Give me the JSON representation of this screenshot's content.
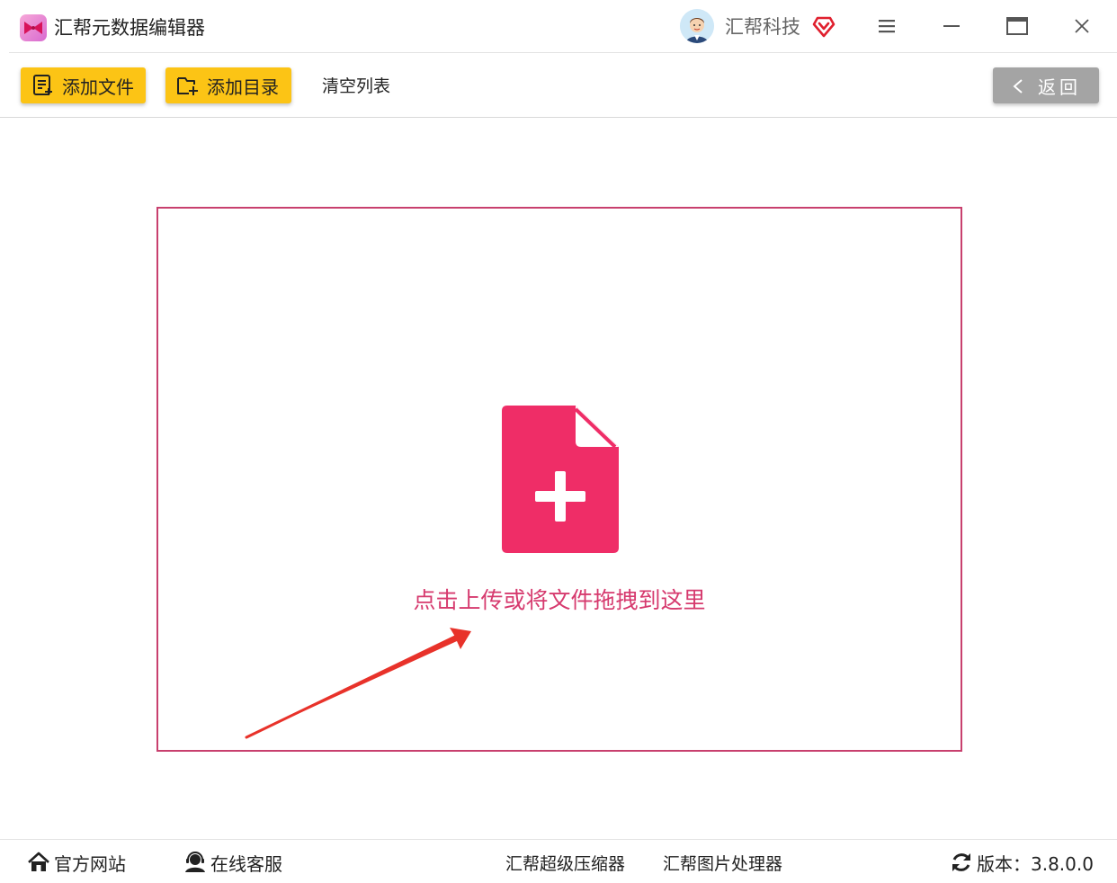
{
  "app": {
    "title": "汇帮元数据编辑器",
    "company": "汇帮科技"
  },
  "toolbar": {
    "add_file_label": "添加文件",
    "add_folder_label": "添加目录",
    "clear_label": "清空列表",
    "back_label": "返回"
  },
  "dropzone": {
    "prompt": "点击上传或将文件拖拽到这里"
  },
  "footer": {
    "website_label": "官方网站",
    "support_label": "在线客服",
    "compressor_label": "汇帮超级压缩器",
    "image_tool_label": "汇帮图片处理器",
    "version_text": "版本：3.8.0.0"
  },
  "colors": {
    "accent_yellow": "#fcc415",
    "accent_pink": "#ef2d67",
    "border_pink": "#c8406e",
    "back_gray": "#a4a4a4",
    "arrow_red": "#e8322a"
  }
}
